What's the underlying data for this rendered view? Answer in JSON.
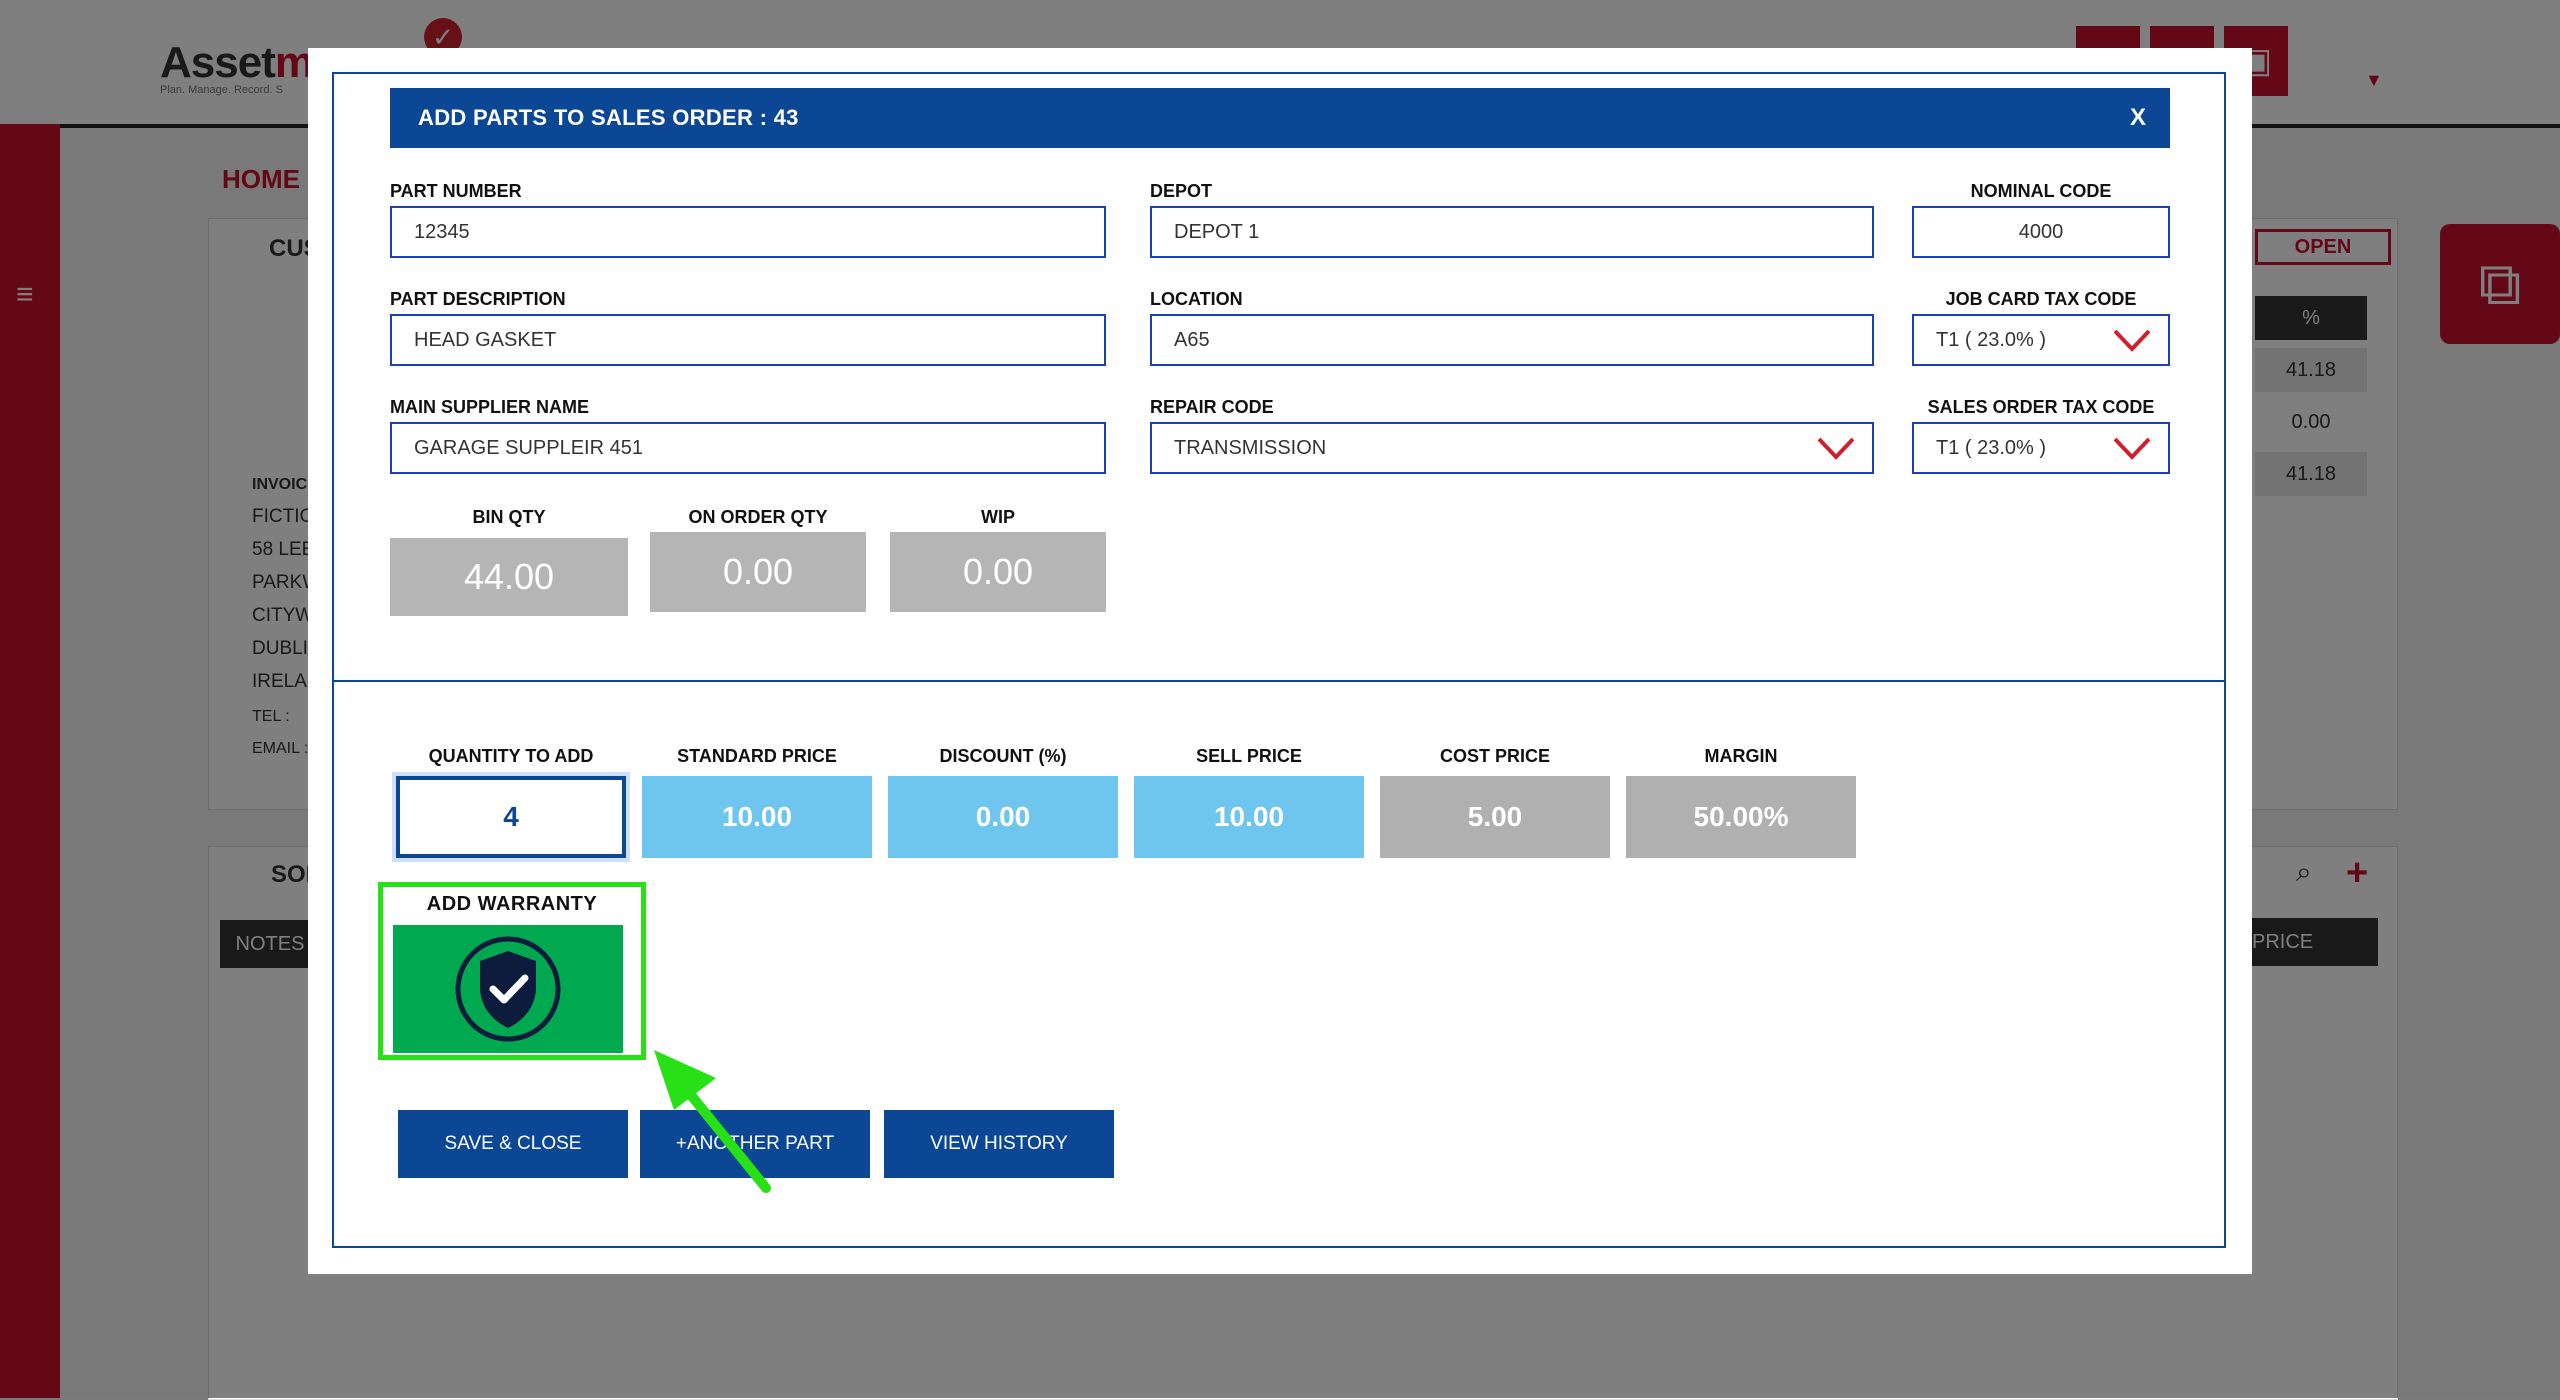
{
  "background_app": {
    "logo_text_a": "Asset",
    "logo_text_b": "m",
    "logo_tagline": "Plan. Manage. Record. S",
    "home_label": "HOME P",
    "customer_panel_title": "CUS",
    "invoice_label": "INVOIC",
    "address_lines": [
      "FICTIC",
      "58 LEE",
      "PARKW",
      "CITYW",
      "DUBLI",
      "IRELA"
    ],
    "tel_label": "TEL :",
    "email_label": "EMAIL :",
    "status_badge": "OPEN",
    "pct_header": "%",
    "pct_values": [
      "41.18",
      "0.00",
      "41.18"
    ],
    "orders_panel_title": "SOF",
    "notes_header": "NOTES",
    "price_header": "PRICE"
  },
  "modal": {
    "title": "ADD PARTS TO SALES ORDER : 43",
    "close_label": "X",
    "fields": {
      "part_number": {
        "label": "PART NUMBER",
        "value": "12345"
      },
      "depot": {
        "label": "DEPOT",
        "value": "DEPOT 1"
      },
      "nominal_code": {
        "label": "NOMINAL CODE",
        "value": "4000"
      },
      "part_description": {
        "label": "PART DESCRIPTION",
        "value": "HEAD GASKET"
      },
      "location": {
        "label": "LOCATION",
        "value": "A65"
      },
      "job_card_tax_code": {
        "label": "JOB CARD TAX CODE",
        "value": "T1 ( 23.0% )"
      },
      "main_supplier_name": {
        "label": "MAIN SUPPLIER NAME",
        "value": "GARAGE SUPPLEIR 451"
      },
      "repair_code": {
        "label": "REPAIR CODE",
        "value": "TRANSMISSION"
      },
      "sales_order_tax_code": {
        "label": "SALES ORDER TAX CODE",
        "value": "T1 ( 23.0% )"
      }
    },
    "stock": {
      "bin_qty": {
        "label": "BIN QTY",
        "value": "44.00"
      },
      "on_order_qty": {
        "label": "ON ORDER QTY",
        "value": "0.00"
      },
      "wip": {
        "label": "WIP",
        "value": "0.00"
      }
    },
    "pricing": {
      "quantity_to_add": {
        "label": "QUANTITY TO ADD",
        "value": "4"
      },
      "standard_price": {
        "label": "STANDARD PRICE",
        "value": "10.00"
      },
      "discount": {
        "label": "DISCOUNT (%)",
        "value": "0.00"
      },
      "sell_price": {
        "label": "SELL PRICE",
        "value": "10.00"
      },
      "cost_price": {
        "label": "COST PRICE",
        "value": "5.00"
      },
      "margin": {
        "label": "MARGIN",
        "value": "50.00%"
      }
    },
    "warranty": {
      "label": "ADD WARRANTY",
      "icon": "shield-check-icon"
    },
    "actions": {
      "save_close": "SAVE & CLOSE",
      "another_part": "+ANOTHER PART",
      "view_history": "VIEW HISTORY"
    }
  },
  "colors": {
    "brand_blue": "#0b4794",
    "input_blue": "#6ec6ee",
    "warranty_green": "#00a94f",
    "highlight_green": "#27e015",
    "brand_red": "#c8102e"
  }
}
